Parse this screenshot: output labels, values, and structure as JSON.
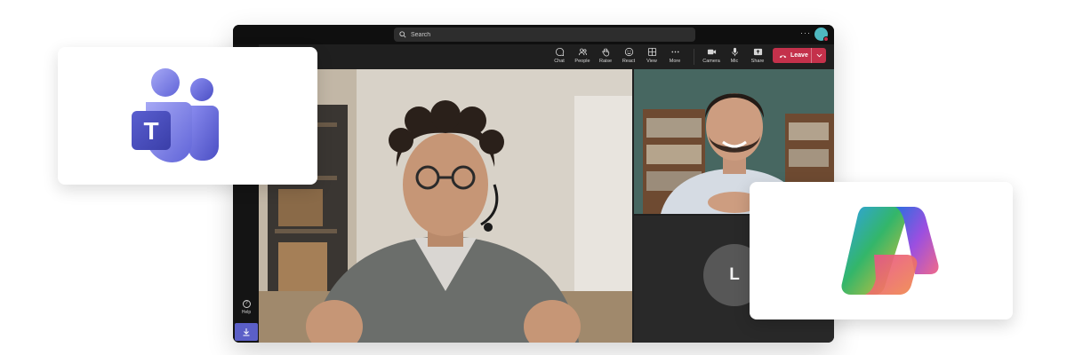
{
  "search": {
    "placeholder": "Search"
  },
  "titlebar": {
    "more_label": "···"
  },
  "toolbar": {
    "items": [
      {
        "label": "Chat",
        "icon": "chat-icon"
      },
      {
        "label": "People",
        "icon": "people-icon"
      },
      {
        "label": "Raise",
        "icon": "raise-hand-icon"
      },
      {
        "label": "React",
        "icon": "react-icon"
      },
      {
        "label": "View",
        "icon": "view-icon"
      },
      {
        "label": "More",
        "icon": "more-icon"
      },
      {
        "label": "Camera",
        "icon": "camera-icon"
      },
      {
        "label": "Mic",
        "icon": "mic-icon"
      },
      {
        "label": "Share",
        "icon": "share-icon"
      }
    ],
    "leave_label": "Leave"
  },
  "rail": {
    "help_label": "Help"
  },
  "participant": {
    "initial": "L"
  },
  "logos": {
    "teams_letter": "T"
  },
  "colors": {
    "leave": "#c4314b",
    "accent": "#5b5fc7",
    "app_background": "#1f1f1f"
  }
}
